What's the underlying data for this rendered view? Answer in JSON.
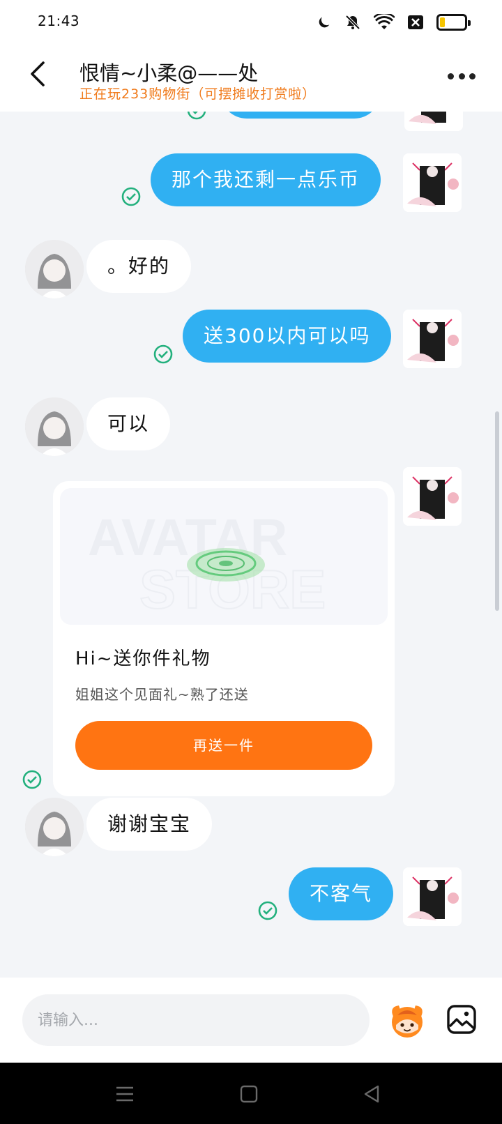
{
  "status_bar": {
    "time": "21:43",
    "icons": [
      "moon-icon",
      "bell-off-icon",
      "wifi-icon",
      "sim-off-icon",
      "battery-icon"
    ],
    "battery_level": 0.2
  },
  "header": {
    "title": "恨情~小柔@——处",
    "subtitle": "正在玩233购物街（可摆摊收打赏啦）"
  },
  "messages": [
    {
      "from": "me",
      "text": "那个我还剩一点乐币",
      "status": "sent"
    },
    {
      "from": "them",
      "text": "。好的"
    },
    {
      "from": "me",
      "text": "送300以内可以吗",
      "status": "sent"
    },
    {
      "from": "them",
      "text": "可以"
    },
    {
      "from": "me",
      "text": "谢谢宝宝"
    },
    {
      "from": "me",
      "text": "不客气",
      "status": "sent"
    }
  ],
  "gift_card": {
    "title": "Hi~送你件礼物",
    "description": "姐姐这个见面礼~熟了还送",
    "button_label": "再送一件",
    "banner_watermark_1": "AVATAR",
    "banner_watermark_2": "STORE"
  },
  "input": {
    "placeholder": "请输入..."
  },
  "colors": {
    "my_bubble": "#30b0f2",
    "their_bubble": "#ffffff",
    "accent_orange": "#ff7412",
    "subtitle_orange": "#f07a1a",
    "sent_check": "#22b07d"
  }
}
